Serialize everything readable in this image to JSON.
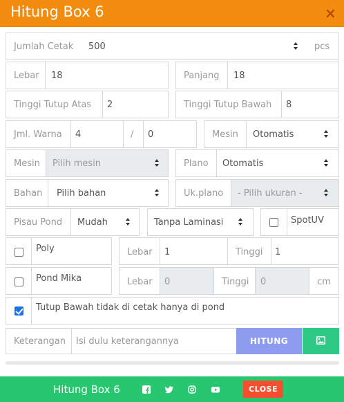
{
  "window": {
    "title": "Hitung Box 6",
    "close_symbol": "×"
  },
  "form": {
    "jumlah_cetak": {
      "label": "Jumlah Cetak",
      "value": "500",
      "unit": "pcs"
    },
    "lebar": {
      "label": "Lebar",
      "value": "18"
    },
    "panjang": {
      "label": "Panjang",
      "value": "18"
    },
    "tinggi_tutup_atas": {
      "label": "Tinggi Tutup Atas",
      "value": "2"
    },
    "tinggi_tutup_bawah": {
      "label": "Tinggi Tutup Bawah",
      "value": "8"
    },
    "jml_warna": {
      "label": "Jml. Warna",
      "value1": "4",
      "separator": "/",
      "value2": "0"
    },
    "mesin_cetak": {
      "label": "Mesin",
      "value": "Otomatis"
    },
    "mesin": {
      "label": "Mesin",
      "value": "Pilih mesin"
    },
    "plano": {
      "label": "Plano",
      "value": "Otomatis"
    },
    "bahan": {
      "label": "Bahan",
      "value": "Pilih bahan"
    },
    "uk_plano": {
      "label": "Uk.plano",
      "value": "- Pilih ukuran -"
    },
    "pisau_pond": {
      "label": "Pisau Pond",
      "value": "Mudah"
    },
    "laminasi": {
      "value": "Tanpa Laminasi"
    },
    "spot_uv": {
      "label": "SpotUV",
      "checked": false
    },
    "poly": {
      "label": "Poly",
      "checked": false,
      "lebar_label": "Lebar",
      "lebar_value": "1",
      "tinggi_label": "Tinggi",
      "tinggi_value": "1"
    },
    "pond_mika": {
      "label": "Pond Mika",
      "checked": false,
      "lebar_label": "Lebar",
      "lebar_value": "0",
      "tinggi_label": "Tinggi",
      "tinggi_value": "0",
      "unit": "cm"
    },
    "tutup_bawah": {
      "label": "Tutup Bawah tidak di cetak hanya di pond",
      "checked": true
    },
    "keterangan": {
      "label": "Keterangan",
      "placeholder": "Isi dulu keterangannya"
    }
  },
  "actions": {
    "hitung_label": "HITUNG",
    "image_icon": "image-icon"
  },
  "footer": {
    "title": "Hitung Box 6",
    "icons": [
      "facebook-icon",
      "twitter-icon",
      "instagram-icon",
      "youtube-icon"
    ],
    "close_label": "CLOSE"
  },
  "colors": {
    "header": "#f28c0f",
    "footer": "#28c76f",
    "hitung": "#8e9cf0",
    "image_button": "#2ec985",
    "close_button": "#f44f2f",
    "checkbox_on": "#1a73e8"
  }
}
